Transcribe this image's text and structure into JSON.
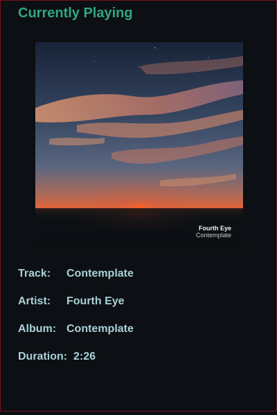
{
  "header": {
    "title": "Currently Playing"
  },
  "cover_art": {
    "artist_text": "Fourth Eye",
    "album_text": "Contemplate",
    "palette": {
      "sky_top": "#1c2a40",
      "sky_mid": "#4a5670",
      "horizon_glow": "#e0653a",
      "cloud": "#e8a27a",
      "ground": "#0d1014"
    }
  },
  "track_info": {
    "track_label": "Track:",
    "track_value": "Contemplate",
    "artist_label": "Artist:",
    "artist_value": "Fourth Eye",
    "album_label": "Album:",
    "album_value": "Contemplate",
    "duration_label": "Duration:",
    "duration_value": "2:26"
  },
  "colors": {
    "background": "#0c0f13",
    "title": "#2fa784",
    "text": "#a9d2d8",
    "border": "#7a1020"
  }
}
